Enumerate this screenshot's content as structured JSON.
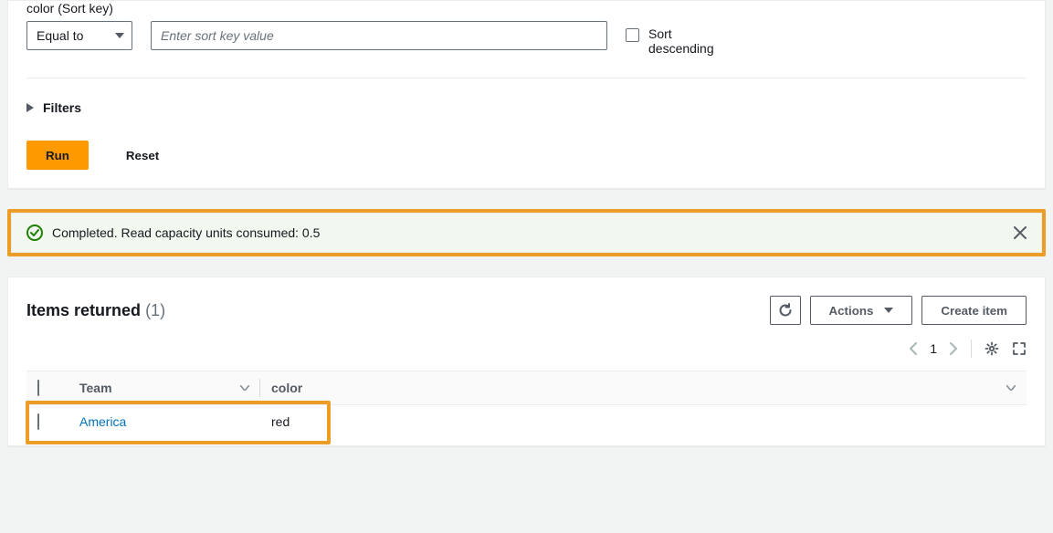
{
  "query": {
    "sort_key_label": "color (Sort key)",
    "operator": "Equal to",
    "sort_key_placeholder": "Enter sort key value",
    "sort_key_value": "",
    "sort_desc_label": "Sort descending",
    "filters_label": "Filters",
    "run_label": "Run",
    "reset_label": "Reset"
  },
  "alert": {
    "message": "Completed. Read capacity units consumed: 0.5"
  },
  "results": {
    "title": "Items returned",
    "count_text": "(1)",
    "refresh_label": "",
    "actions_label": "Actions",
    "create_label": "Create item",
    "page": "1",
    "columns": [
      "Team",
      "color"
    ],
    "rows": [
      {
        "Team": "America",
        "color": "red"
      }
    ]
  }
}
